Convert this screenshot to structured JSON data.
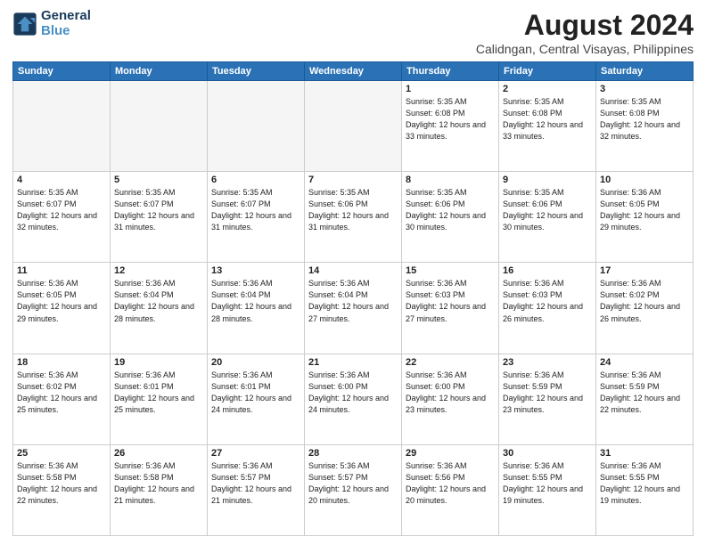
{
  "header": {
    "logo_line1": "General",
    "logo_line2": "Blue",
    "month_year": "August 2024",
    "location": "Calidngan, Central Visayas, Philippines"
  },
  "weekdays": [
    "Sunday",
    "Monday",
    "Tuesday",
    "Wednesday",
    "Thursday",
    "Friday",
    "Saturday"
  ],
  "weeks": [
    [
      {
        "day": "",
        "empty": true
      },
      {
        "day": "",
        "empty": true
      },
      {
        "day": "",
        "empty": true
      },
      {
        "day": "",
        "empty": true
      },
      {
        "day": "1",
        "sunrise": "5:35 AM",
        "sunset": "6:08 PM",
        "daylight": "12 hours and 33 minutes."
      },
      {
        "day": "2",
        "sunrise": "5:35 AM",
        "sunset": "6:08 PM",
        "daylight": "12 hours and 33 minutes."
      },
      {
        "day": "3",
        "sunrise": "5:35 AM",
        "sunset": "6:08 PM",
        "daylight": "12 hours and 32 minutes."
      }
    ],
    [
      {
        "day": "4",
        "sunrise": "5:35 AM",
        "sunset": "6:07 PM",
        "daylight": "12 hours and 32 minutes."
      },
      {
        "day": "5",
        "sunrise": "5:35 AM",
        "sunset": "6:07 PM",
        "daylight": "12 hours and 31 minutes."
      },
      {
        "day": "6",
        "sunrise": "5:35 AM",
        "sunset": "6:07 PM",
        "daylight": "12 hours and 31 minutes."
      },
      {
        "day": "7",
        "sunrise": "5:35 AM",
        "sunset": "6:06 PM",
        "daylight": "12 hours and 31 minutes."
      },
      {
        "day": "8",
        "sunrise": "5:35 AM",
        "sunset": "6:06 PM",
        "daylight": "12 hours and 30 minutes."
      },
      {
        "day": "9",
        "sunrise": "5:35 AM",
        "sunset": "6:06 PM",
        "daylight": "12 hours and 30 minutes."
      },
      {
        "day": "10",
        "sunrise": "5:36 AM",
        "sunset": "6:05 PM",
        "daylight": "12 hours and 29 minutes."
      }
    ],
    [
      {
        "day": "11",
        "sunrise": "5:36 AM",
        "sunset": "6:05 PM",
        "daylight": "12 hours and 29 minutes."
      },
      {
        "day": "12",
        "sunrise": "5:36 AM",
        "sunset": "6:04 PM",
        "daylight": "12 hours and 28 minutes."
      },
      {
        "day": "13",
        "sunrise": "5:36 AM",
        "sunset": "6:04 PM",
        "daylight": "12 hours and 28 minutes."
      },
      {
        "day": "14",
        "sunrise": "5:36 AM",
        "sunset": "6:04 PM",
        "daylight": "12 hours and 27 minutes."
      },
      {
        "day": "15",
        "sunrise": "5:36 AM",
        "sunset": "6:03 PM",
        "daylight": "12 hours and 27 minutes."
      },
      {
        "day": "16",
        "sunrise": "5:36 AM",
        "sunset": "6:03 PM",
        "daylight": "12 hours and 26 minutes."
      },
      {
        "day": "17",
        "sunrise": "5:36 AM",
        "sunset": "6:02 PM",
        "daylight": "12 hours and 26 minutes."
      }
    ],
    [
      {
        "day": "18",
        "sunrise": "5:36 AM",
        "sunset": "6:02 PM",
        "daylight": "12 hours and 25 minutes."
      },
      {
        "day": "19",
        "sunrise": "5:36 AM",
        "sunset": "6:01 PM",
        "daylight": "12 hours and 25 minutes."
      },
      {
        "day": "20",
        "sunrise": "5:36 AM",
        "sunset": "6:01 PM",
        "daylight": "12 hours and 24 minutes."
      },
      {
        "day": "21",
        "sunrise": "5:36 AM",
        "sunset": "6:00 PM",
        "daylight": "12 hours and 24 minutes."
      },
      {
        "day": "22",
        "sunrise": "5:36 AM",
        "sunset": "6:00 PM",
        "daylight": "12 hours and 23 minutes."
      },
      {
        "day": "23",
        "sunrise": "5:36 AM",
        "sunset": "5:59 PM",
        "daylight": "12 hours and 23 minutes."
      },
      {
        "day": "24",
        "sunrise": "5:36 AM",
        "sunset": "5:59 PM",
        "daylight": "12 hours and 22 minutes."
      }
    ],
    [
      {
        "day": "25",
        "sunrise": "5:36 AM",
        "sunset": "5:58 PM",
        "daylight": "12 hours and 22 minutes."
      },
      {
        "day": "26",
        "sunrise": "5:36 AM",
        "sunset": "5:58 PM",
        "daylight": "12 hours and 21 minutes."
      },
      {
        "day": "27",
        "sunrise": "5:36 AM",
        "sunset": "5:57 PM",
        "daylight": "12 hours and 21 minutes."
      },
      {
        "day": "28",
        "sunrise": "5:36 AM",
        "sunset": "5:57 PM",
        "daylight": "12 hours and 20 minutes."
      },
      {
        "day": "29",
        "sunrise": "5:36 AM",
        "sunset": "5:56 PM",
        "daylight": "12 hours and 20 minutes."
      },
      {
        "day": "30",
        "sunrise": "5:36 AM",
        "sunset": "5:55 PM",
        "daylight": "12 hours and 19 minutes."
      },
      {
        "day": "31",
        "sunrise": "5:36 AM",
        "sunset": "5:55 PM",
        "daylight": "12 hours and 19 minutes."
      }
    ]
  ],
  "labels": {
    "sunrise": "Sunrise:",
    "sunset": "Sunset:",
    "daylight": "Daylight:"
  }
}
